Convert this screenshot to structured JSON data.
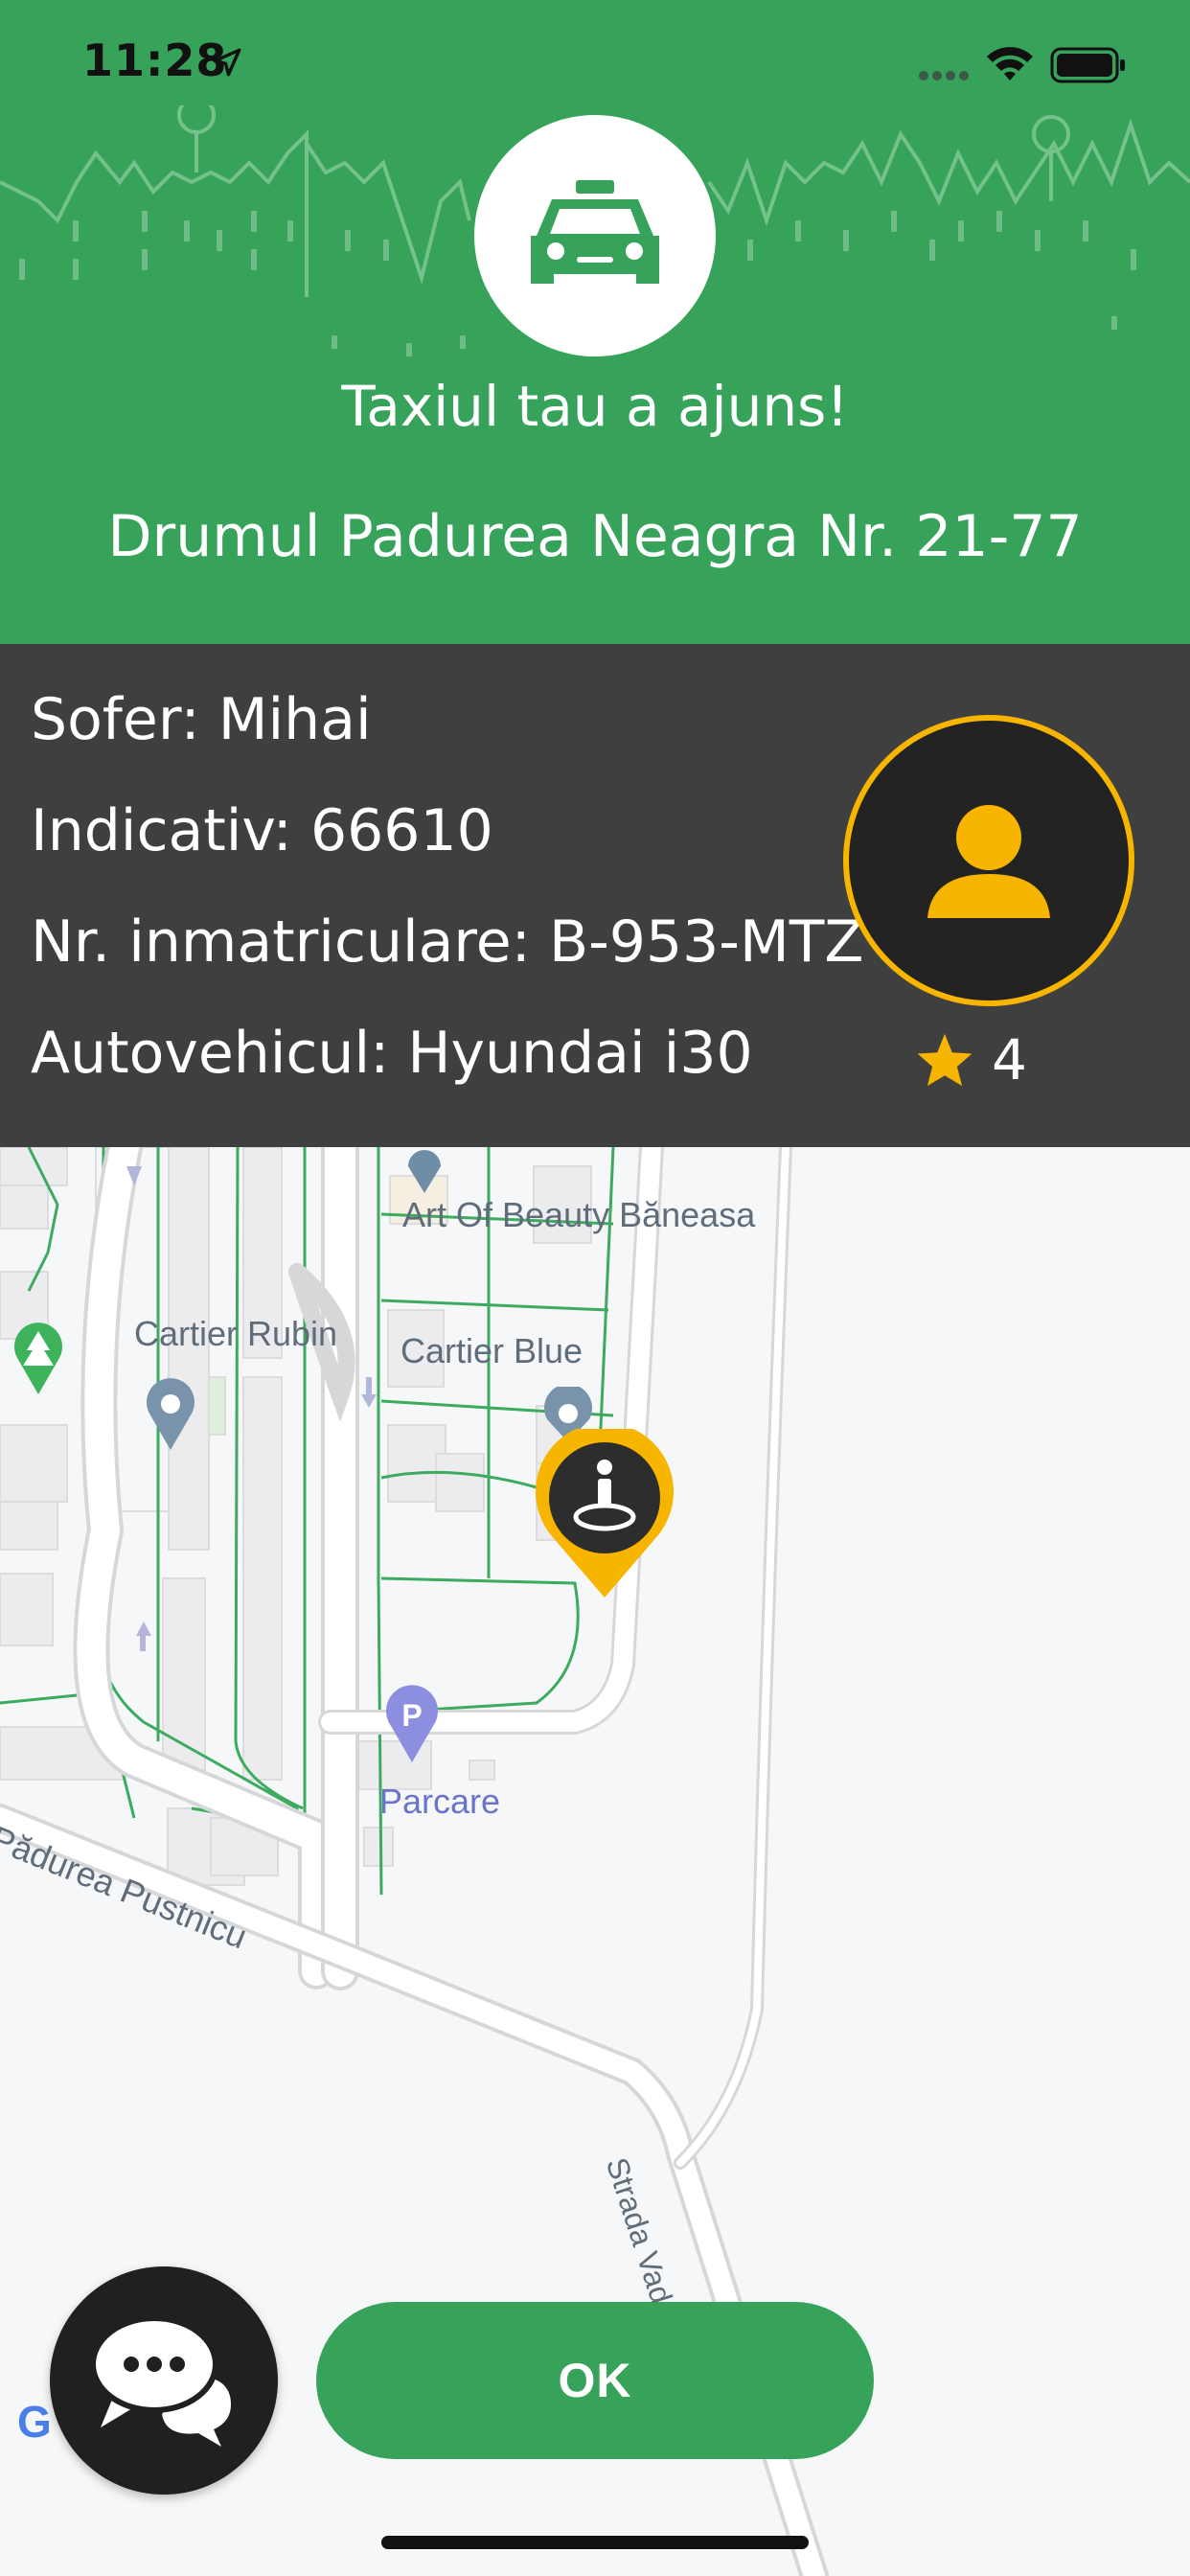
{
  "status_bar": {
    "time": "11:28"
  },
  "header": {
    "title": "Taxiul tau a ajuns!",
    "address": "Drumul Padurea Neagra Nr. 21-77"
  },
  "driver": {
    "sofer": "Sofer: Mihai",
    "indicativ": "Indicativ: 66610",
    "nr_inmatriculare": "Nr. inmatriculare: B-953-MTZ",
    "autovehicul": "Autovehicul: Hyundai i30",
    "rating": "4"
  },
  "map": {
    "labels": {
      "art_of_beauty": "Art Of Beauty Băneasa",
      "cartier_rubin": "Cartier Rubin",
      "cartier_blue": "Cartier Blue",
      "parcare": "Parcare",
      "padurea_pustnicu": "Pădurea Pustnicu",
      "strada_vad": "Strada Vad"
    },
    "google_logo": "G"
  },
  "buttons": {
    "ok": "OK"
  },
  "icons": {
    "taxi": "taxi-icon",
    "avatar": "user-icon",
    "star": "star-icon",
    "chat": "chat-icon",
    "location": "location-arrow-icon",
    "wifi": "wifi-icon",
    "battery": "battery-icon",
    "pickup_pin": "pickup-pin-icon"
  },
  "colors": {
    "brand_green": "#37a35a",
    "panel_dark": "#3f3f3f",
    "accent_yellow": "#f7b500"
  }
}
